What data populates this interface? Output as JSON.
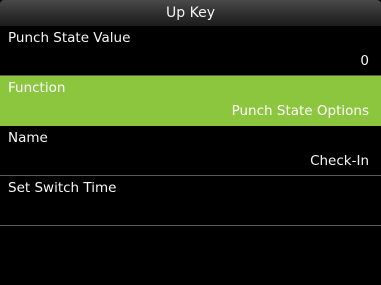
{
  "header": {
    "title": "Up Key"
  },
  "menu": {
    "items": [
      {
        "label": "Punch State Value",
        "value": "0"
      },
      {
        "label": "Function",
        "value": "Punch State Options"
      },
      {
        "label": "Name",
        "value": "Check-In"
      },
      {
        "label": "Set Switch Time",
        "value": ""
      }
    ],
    "selected_index": 1
  },
  "colors": {
    "selected_background": "#8cc63f",
    "background": "#000000",
    "divider": "#5a5a5a"
  }
}
